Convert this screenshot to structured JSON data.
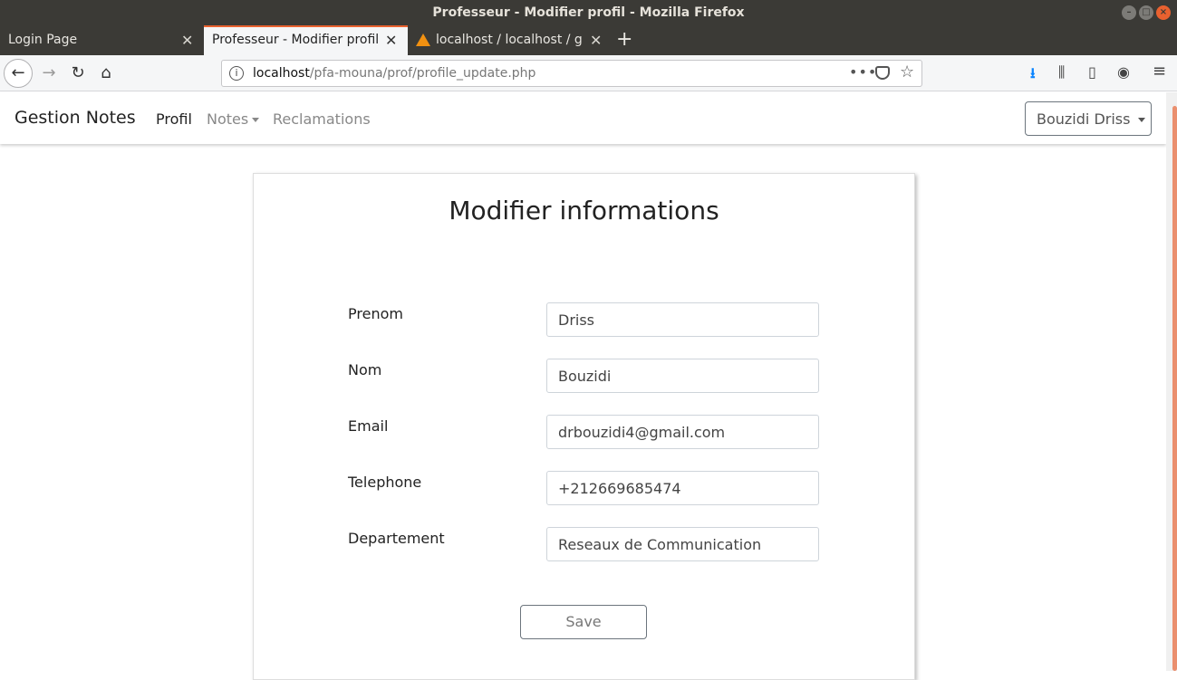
{
  "window": {
    "title": "Professeur - Modifier profil - Mozilla Firefox"
  },
  "tabs": [
    {
      "label": "Login Page"
    },
    {
      "label": "Professeur - Modifier profil"
    },
    {
      "label": "localhost / localhost / ge"
    }
  ],
  "address_bar": {
    "host": "localhost",
    "path": "/pfa-mouna/prof/profile_update.php"
  },
  "app_nav": {
    "brand": "Gestion Notes",
    "links": [
      "Profil",
      "Notes",
      "Reclamations"
    ],
    "user": "Bouzidi Driss"
  },
  "form": {
    "heading": "Modifier informations",
    "fields": [
      {
        "label": "Prenom",
        "value": "Driss"
      },
      {
        "label": "Nom",
        "value": "Bouzidi"
      },
      {
        "label": "Email",
        "value": "drbouzidi4@gmail.com"
      },
      {
        "label": "Telephone",
        "value": "+212669685474"
      },
      {
        "label": "Departement",
        "value": "Reseaux de Communication"
      }
    ],
    "save_label": "Save"
  },
  "colors": {
    "accent": "#e9612f",
    "titlebar": "#3b3a36",
    "download": "#0a84ff"
  }
}
